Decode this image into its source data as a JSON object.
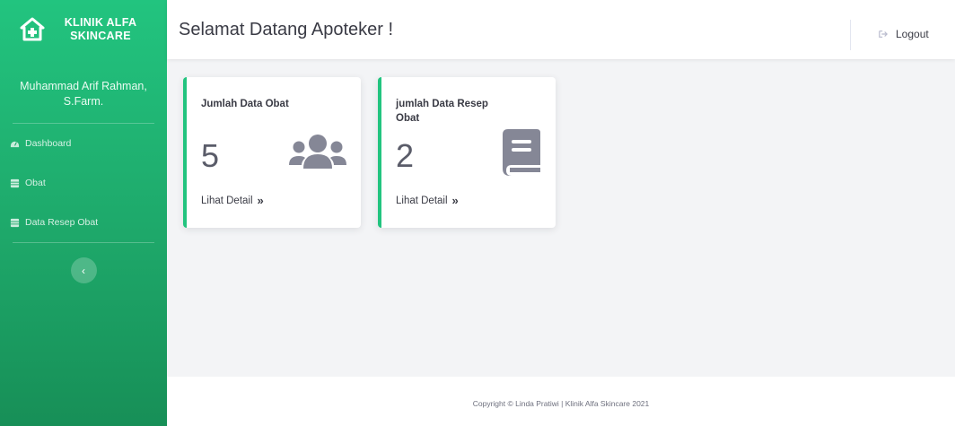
{
  "sidebar": {
    "brand_title": "KLINIK ALFA SKINCARE",
    "brand_icon": "clinic-house-icon",
    "user_name": "Muhammad Arif Rahman, S.Farm.",
    "items": [
      {
        "label": "Dashboard",
        "icon": "dashboard-icon"
      },
      {
        "label": "Obat",
        "icon": "table-icon"
      },
      {
        "label": "Data Resep Obat",
        "icon": "table-icon"
      }
    ],
    "toggle_label": "‹"
  },
  "header": {
    "welcome": "Selamat Datang Apoteker !",
    "logout_label": "Logout",
    "logout_icon": "sign-out-icon"
  },
  "cards": [
    {
      "title": "Jumlah Data Obat",
      "value": "5",
      "link": "Lihat Detail",
      "icon": "users-icon"
    },
    {
      "title": "jumlah Data Resep Obat",
      "value": "2",
      "link": "Lihat Detail",
      "icon": "book-icon"
    }
  ],
  "footer": {
    "text": "Copyright © Linda Pratiwi | Klinik Alfa Skincare 2021"
  },
  "colors": {
    "accent": "#22c47f",
    "sidebar_dark": "#178f57",
    "icon_gray": "#858796",
    "text": "#3a3b45"
  }
}
